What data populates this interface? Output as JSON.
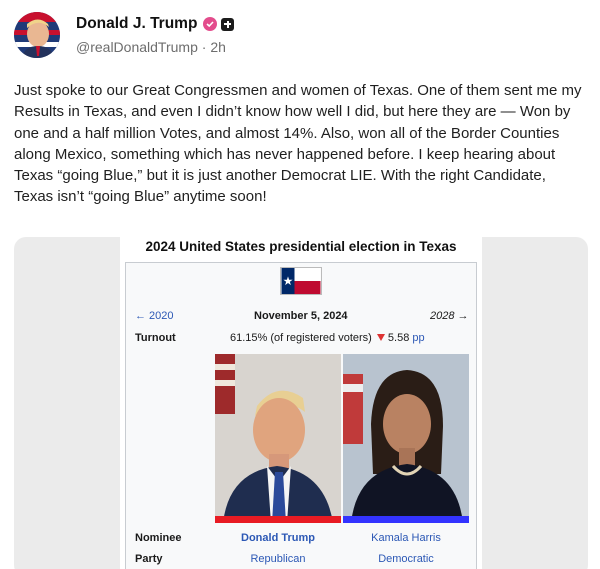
{
  "author": {
    "name": "Donald J. Trump",
    "handle": "@realDonaldTrump",
    "time": "2h",
    "separator": "·",
    "avatar_icon": "portrait-avatar-icon",
    "verified_icon": "verified-badge-icon",
    "plus_icon": "plus-icon"
  },
  "post": {
    "text": "Just spoke to our Great Congressmen and women of Texas. One of them sent me my Results in Texas, and even I didn’t know how well I did, but here they are — Won by one and a half million Votes, and almost 14%. Also, won all of the Border Counties along Mexico, something which has never happened before. I keep hearing about Texas “going Blue,” but it is just another Democrat LIE. With the right Candidate, Texas isn’t “going Blue” anytime soon!"
  },
  "infobox": {
    "title": "2024 United States presidential election in Texas",
    "prev": "← 2020",
    "date": "November 5, 2024",
    "next": "2028 →",
    "turnout_label": "Turnout",
    "turnout_value": "61.15% (of registered voters)",
    "turnout_change": "5.58",
    "turnout_unit": "pp",
    "nominee_label": "Nominee",
    "party_label": "Party",
    "candidates": [
      {
        "name": "Donald Trump",
        "party": "Republican",
        "color": "#e81b23"
      },
      {
        "name": "Kamala Harris",
        "party": "Democratic",
        "color": "#3333ff"
      }
    ]
  },
  "colors": {
    "accent_link": "#2c58b5",
    "verified": "#e34c8c"
  }
}
